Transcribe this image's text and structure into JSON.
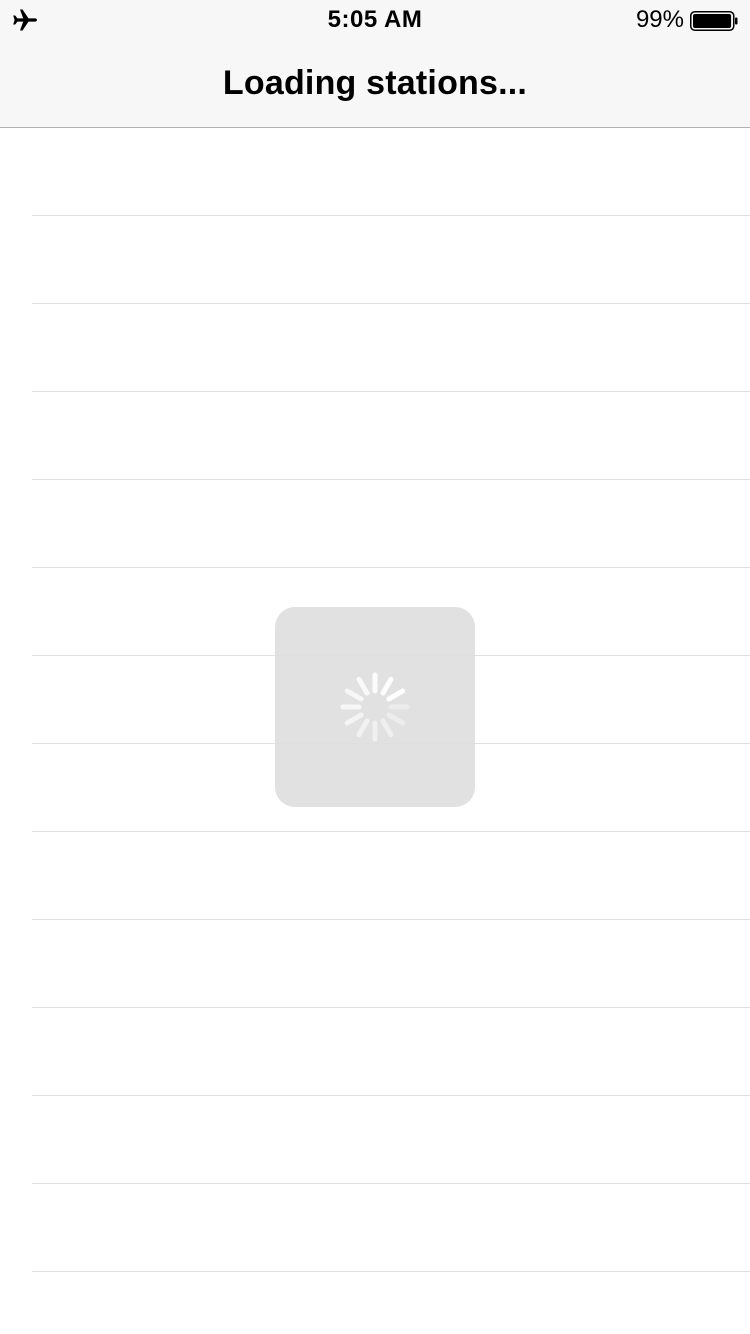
{
  "status_bar": {
    "airplane_icon": "airplane-icon",
    "time": "5:05 AM",
    "battery_percent": "99%",
    "battery_level": 0.99,
    "battery_icon": "battery-icon"
  },
  "nav": {
    "title": "Loading stations..."
  },
  "table": {
    "row_count": 14
  },
  "hud": {
    "spinner_icon": "activity-spinner-icon"
  },
  "colors": {
    "nav_background": "#f7f7f7",
    "separator": "#e0e0e0",
    "hud_background": "#dedede",
    "spinner": "#ffffff"
  }
}
